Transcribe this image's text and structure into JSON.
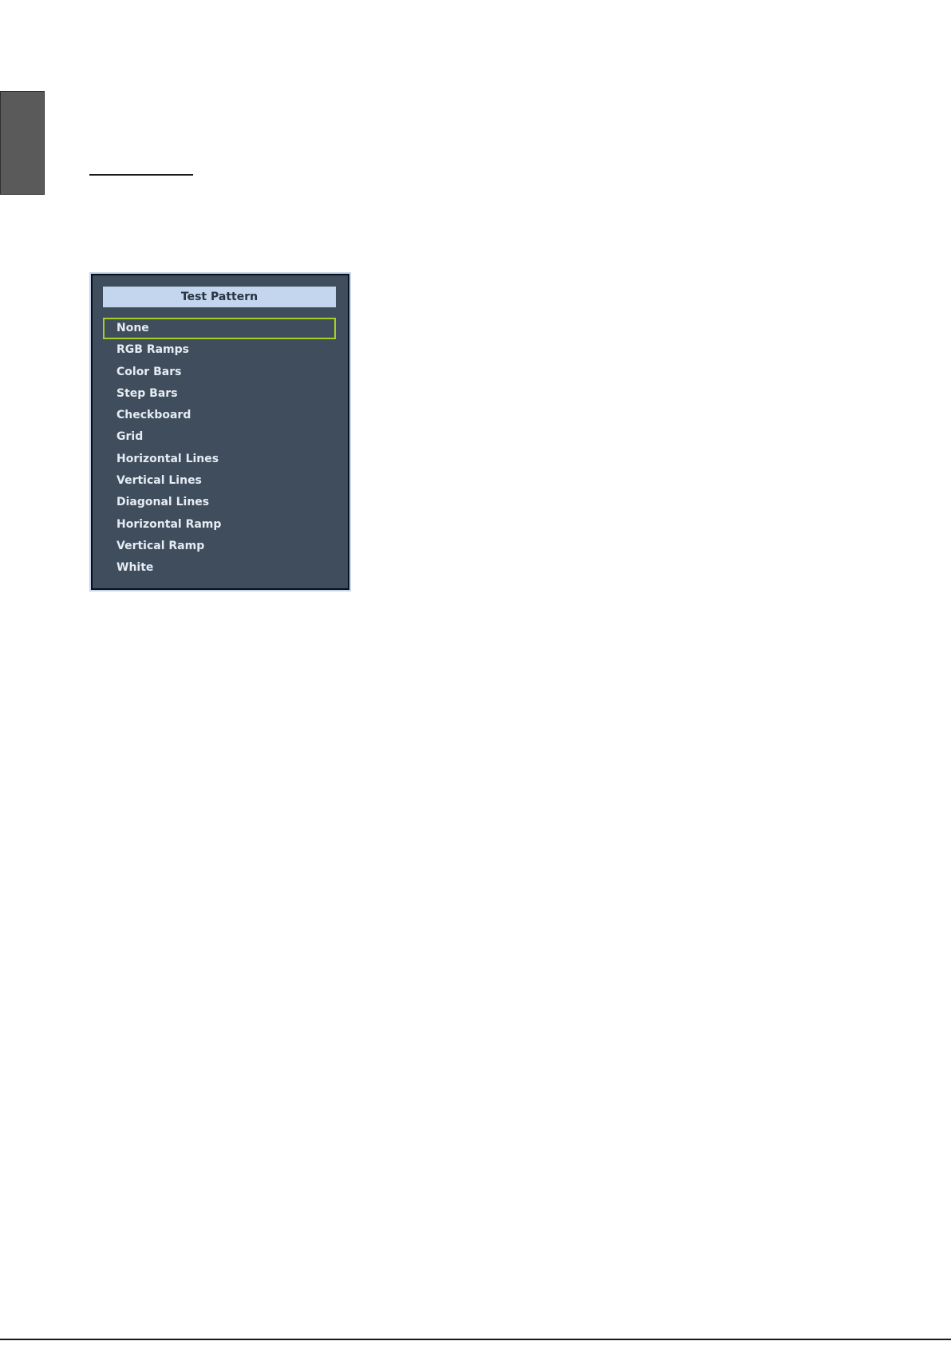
{
  "menu": {
    "title": "Test Pattern",
    "selected_index": 0,
    "items": [
      "None",
      "RGB Ramps",
      "Color Bars",
      "Step Bars",
      "Checkboard",
      "Grid",
      "Horizontal Lines",
      "Vertical Lines",
      "Diagonal Lines",
      "Horizontal Ramp",
      "Vertical Ramp",
      "White"
    ]
  },
  "colors": {
    "panel_bg": "#3f4d5c",
    "title_bg": "#c3d6ee",
    "selection_border": "#a6cf2c",
    "side_tab": "#5a5a5a"
  }
}
